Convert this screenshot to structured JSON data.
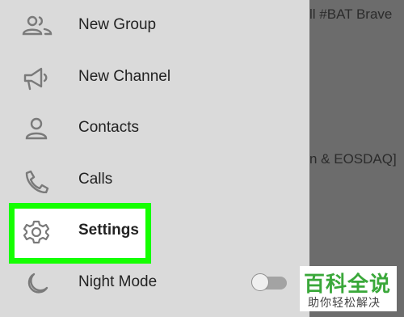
{
  "background_chat": {
    "snippet_1": "ll #BAT  Brave",
    "snippet_2": "n & EOSDAQ]"
  },
  "menu": {
    "items": [
      {
        "label": "New Group",
        "icon": "people-icon"
      },
      {
        "label": "New Channel",
        "icon": "megaphone-icon"
      },
      {
        "label": "Contacts",
        "icon": "person-icon"
      },
      {
        "label": "Calls",
        "icon": "phone-icon"
      },
      {
        "label": "Settings",
        "icon": "gear-icon"
      },
      {
        "label": "Night Mode",
        "icon": "moon-icon"
      }
    ]
  },
  "night_mode": {
    "enabled": false
  },
  "watermark": {
    "main": "百科全说",
    "sub": "助你轻松解决"
  },
  "colors": {
    "highlight": "#14ff00",
    "drawer_bg": "#dadada",
    "icon": "#7a7a7a",
    "watermark_green": "#3aa83a"
  }
}
